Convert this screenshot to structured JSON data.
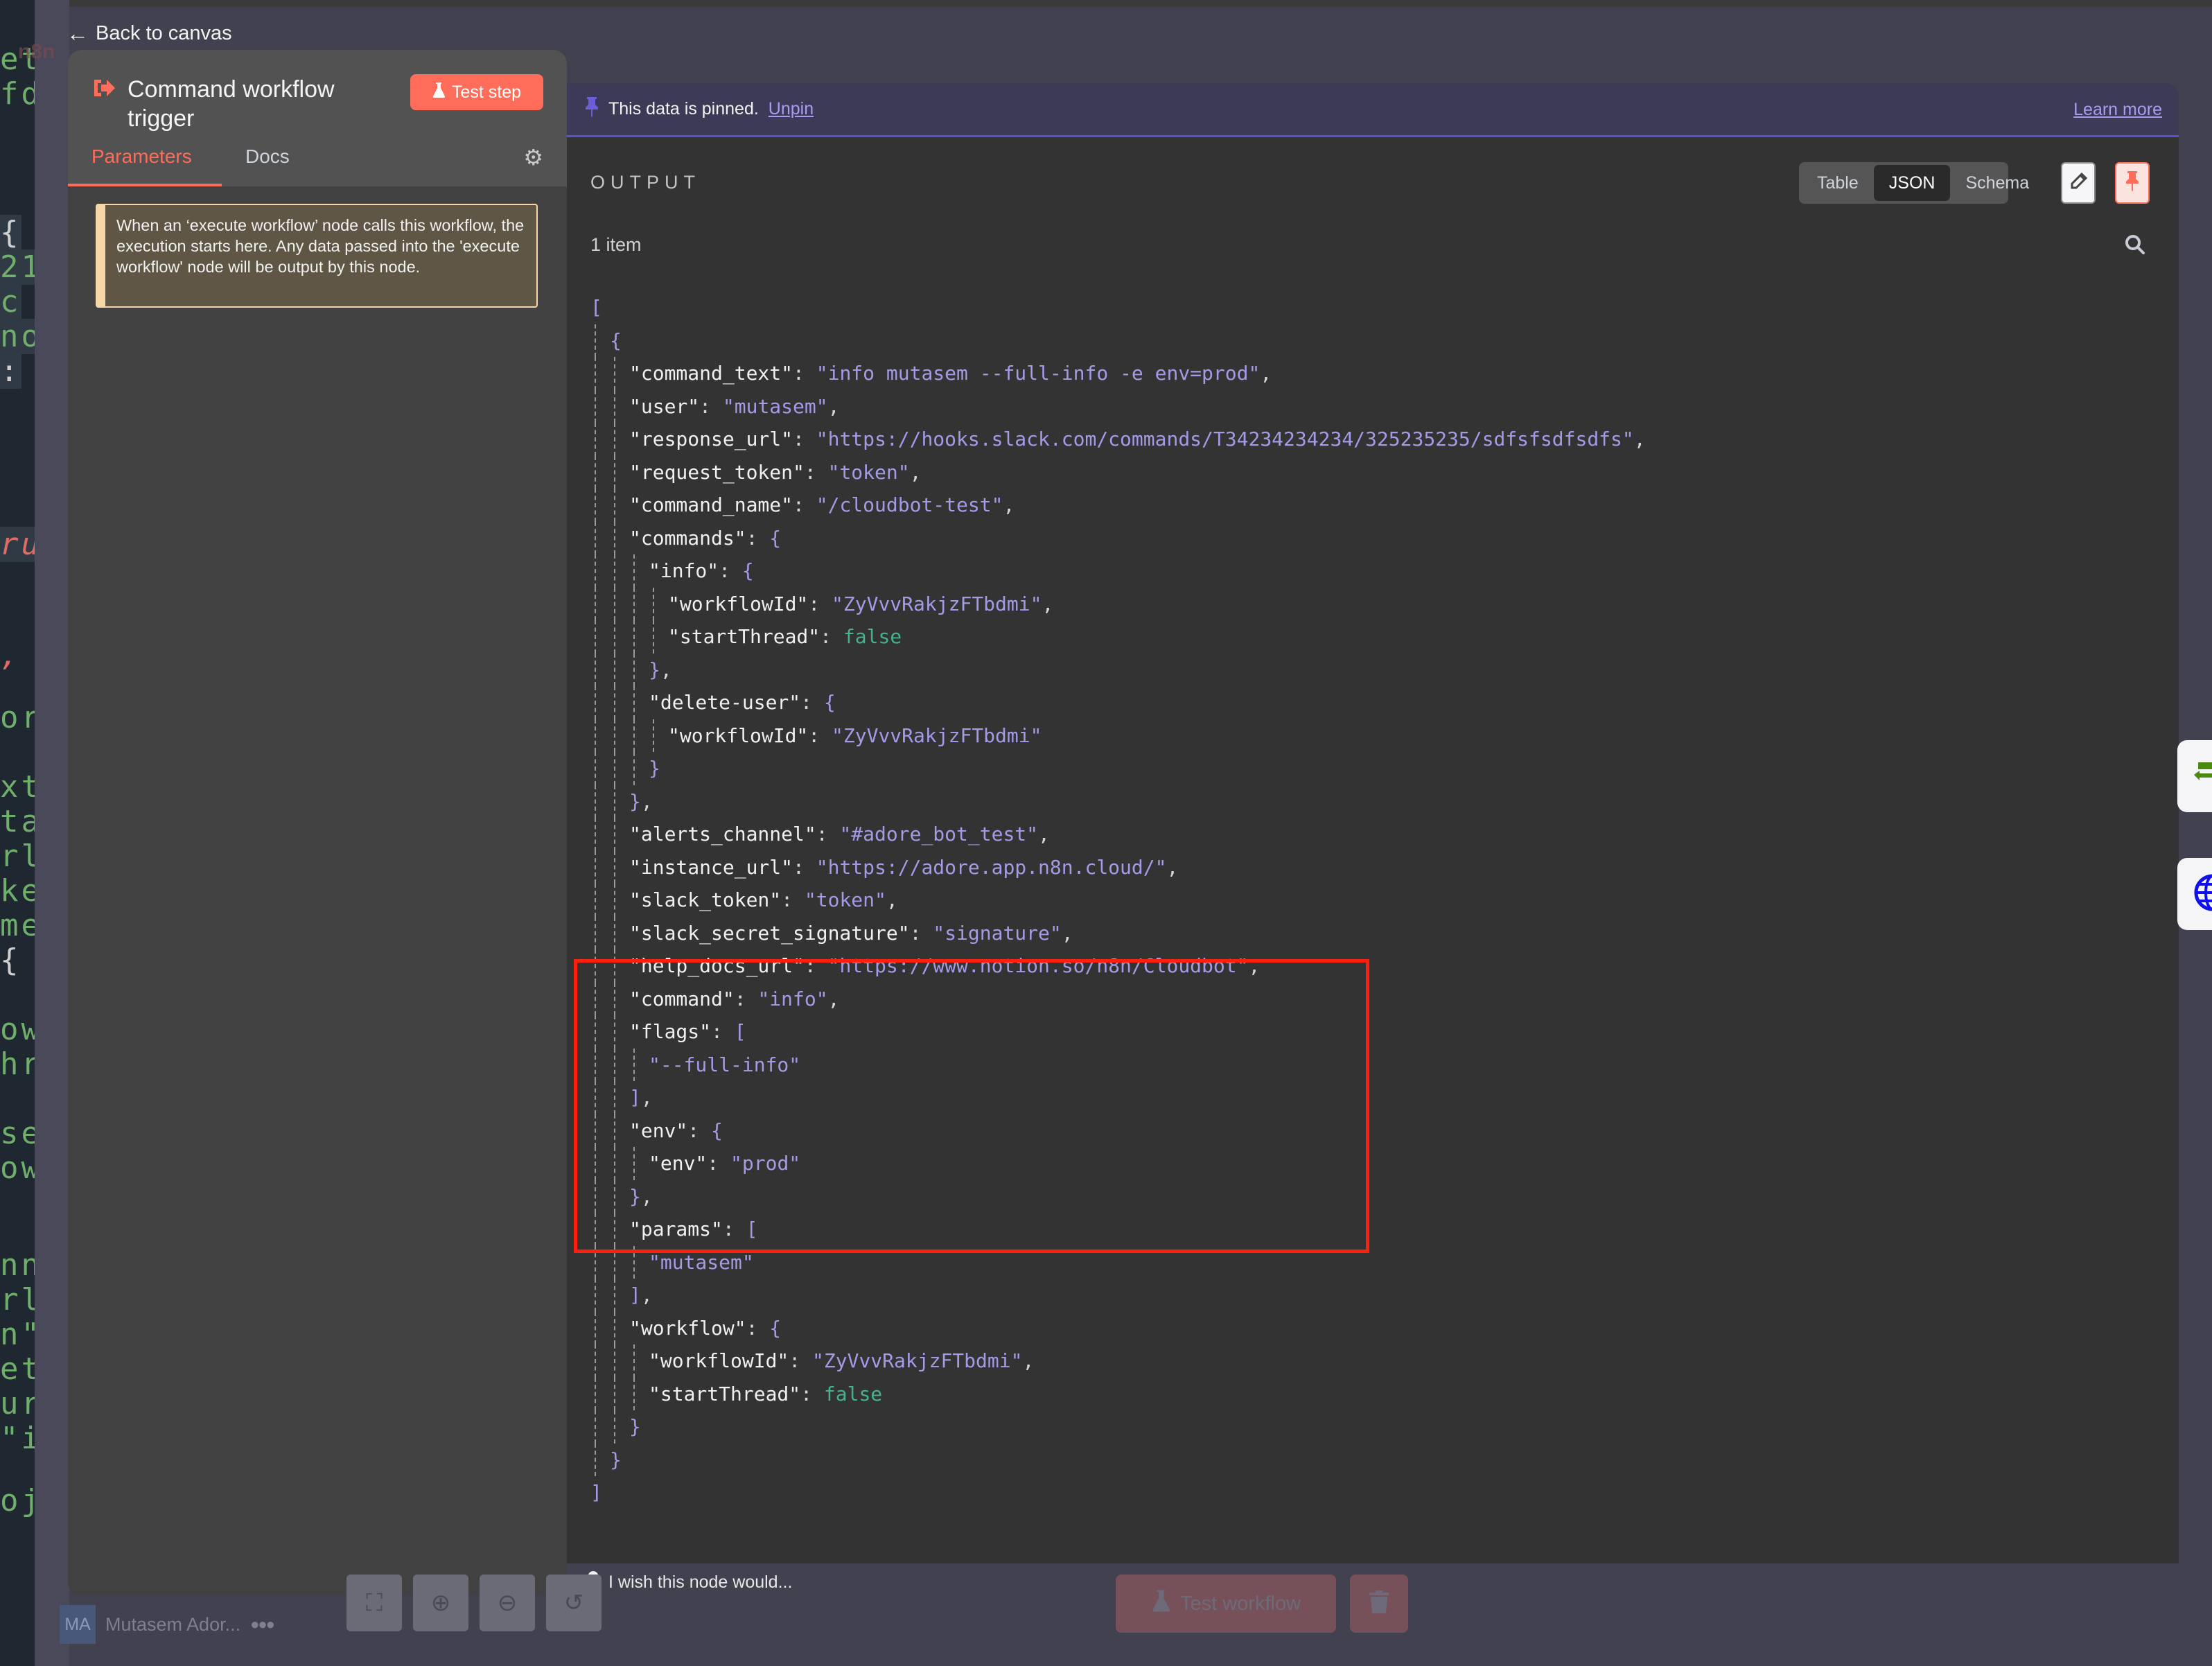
{
  "background_code": {
    "lines": [
      {
        "text": "et",
        "cls": ""
      },
      {
        "text": "fd",
        "cls": ""
      },
      {
        "text": " {",
        "cls": "white hl"
      },
      {
        "text": "21",
        "cls": "hl"
      },
      {
        "text": " c",
        "cls": "hl"
      },
      {
        "text": "no",
        "cls": "hl"
      },
      {
        "text": ":",
        "cls": "white hl"
      },
      {
        "text": "ru",
        "cls": "red hl"
      },
      {
        "text": ",",
        "cls": "red"
      },
      {
        "text": "or",
        "cls": ""
      },
      {
        "text": "xt",
        "cls": ""
      },
      {
        "text": "ta",
        "cls": ""
      },
      {
        "text": "rl",
        "cls": ""
      },
      {
        "text": "ke",
        "cls": ""
      },
      {
        "text": "me",
        "cls": ""
      },
      {
        "text": " {",
        "cls": "white"
      },
      {
        "text": "ow",
        "cls": ""
      },
      {
        "text": "hr",
        "cls": ""
      },
      {
        "text": "se",
        "cls": ""
      },
      {
        "text": "ow",
        "cls": ""
      },
      {
        "text": "nn",
        "cls": ""
      },
      {
        "text": "rl",
        "cls": ""
      },
      {
        "text": "n\"",
        "cls": ""
      },
      {
        "text": "et",
        "cls": ""
      },
      {
        "text": "ur",
        "cls": ""
      },
      {
        "text": "\"i",
        "cls": ""
      },
      {
        "text": "oj",
        "cls": ""
      }
    ]
  },
  "nav": {
    "back_label": "Back to canvas",
    "logo_text": "n8n"
  },
  "node_panel": {
    "title": "Command workflow trigger",
    "test_step_label": "Test step",
    "tabs": [
      {
        "label": "Parameters",
        "active": true
      },
      {
        "label": "Docs",
        "active": false
      }
    ],
    "callout": "When an ‘execute workflow’ node calls this workflow, the execution starts here. Any data passed into the 'execute workflow' node will be output by this node."
  },
  "output_panel": {
    "pinned_text": "This data is pinned.",
    "unpin_label": "Unpin",
    "learn_more_label": "Learn more",
    "section_label": "OUTPUT",
    "view_options": [
      {
        "label": "Table",
        "active": false
      },
      {
        "label": "JSON",
        "active": true
      },
      {
        "label": "Schema",
        "active": false
      }
    ],
    "items_count": "1 item",
    "json_lines": [
      {
        "d": 0,
        "t": [
          [
            "p",
            "["
          ]
        ]
      },
      {
        "d": 1,
        "t": [
          [
            "p",
            "{"
          ]
        ]
      },
      {
        "d": 2,
        "t": [
          [
            "k",
            "\"command_text\""
          ],
          [
            "c",
            ": "
          ],
          [
            "s",
            "\"info mutasem --full-info -e env=prod\""
          ],
          [
            "c",
            ","
          ]
        ]
      },
      {
        "d": 2,
        "t": [
          [
            "k",
            "\"user\""
          ],
          [
            "c",
            ": "
          ],
          [
            "s",
            "\"mutasem\""
          ],
          [
            "c",
            ","
          ]
        ]
      },
      {
        "d": 2,
        "t": [
          [
            "k",
            "\"response_url\""
          ],
          [
            "c",
            ": "
          ],
          [
            "s",
            "\"https://hooks.slack.com/commands/T34234234234/325235235/sdfsfsdfsdfs\""
          ],
          [
            "c",
            ","
          ]
        ]
      },
      {
        "d": 2,
        "t": [
          [
            "k",
            "\"request_token\""
          ],
          [
            "c",
            ": "
          ],
          [
            "s",
            "\"token\""
          ],
          [
            "c",
            ","
          ]
        ]
      },
      {
        "d": 2,
        "t": [
          [
            "k",
            "\"command_name\""
          ],
          [
            "c",
            ": "
          ],
          [
            "s",
            "\"/cloudbot-test\""
          ],
          [
            "c",
            ","
          ]
        ]
      },
      {
        "d": 2,
        "t": [
          [
            "k",
            "\"commands\""
          ],
          [
            "c",
            ": "
          ],
          [
            "p",
            "{"
          ]
        ]
      },
      {
        "d": 3,
        "t": [
          [
            "k",
            "\"info\""
          ],
          [
            "c",
            ": "
          ],
          [
            "p",
            "{"
          ]
        ]
      },
      {
        "d": 4,
        "t": [
          [
            "k",
            "\"workflowId\""
          ],
          [
            "c",
            ": "
          ],
          [
            "s",
            "\"ZyVvvRakjzFTbdmi\""
          ],
          [
            "c",
            ","
          ]
        ]
      },
      {
        "d": 4,
        "t": [
          [
            "k",
            "\"startThread\""
          ],
          [
            "c",
            ": "
          ],
          [
            "b",
            "false"
          ]
        ]
      },
      {
        "d": 3,
        "t": [
          [
            "p",
            "}"
          ],
          [
            "c",
            ","
          ]
        ]
      },
      {
        "d": 3,
        "t": [
          [
            "k",
            "\"delete-user\""
          ],
          [
            "c",
            ": "
          ],
          [
            "p",
            "{"
          ]
        ]
      },
      {
        "d": 4,
        "t": [
          [
            "k",
            "\"workflowId\""
          ],
          [
            "c",
            ": "
          ],
          [
            "s",
            "\"ZyVvvRakjzFTbdmi\""
          ]
        ]
      },
      {
        "d": 3,
        "t": [
          [
            "p",
            "}"
          ]
        ]
      },
      {
        "d": 2,
        "t": [
          [
            "p",
            "}"
          ],
          [
            "c",
            ","
          ]
        ]
      },
      {
        "d": 2,
        "t": [
          [
            "k",
            "\"alerts_channel\""
          ],
          [
            "c",
            ": "
          ],
          [
            "s",
            "\"#adore_bot_test\""
          ],
          [
            "c",
            ","
          ]
        ]
      },
      {
        "d": 2,
        "t": [
          [
            "k",
            "\"instance_url\""
          ],
          [
            "c",
            ": "
          ],
          [
            "s",
            "\"https://adore.app.n8n.cloud/\""
          ],
          [
            "c",
            ","
          ]
        ]
      },
      {
        "d": 2,
        "t": [
          [
            "k",
            "\"slack_token\""
          ],
          [
            "c",
            ": "
          ],
          [
            "s",
            "\"token\""
          ],
          [
            "c",
            ","
          ]
        ]
      },
      {
        "d": 2,
        "t": [
          [
            "k",
            "\"slack_secret_signature\""
          ],
          [
            "c",
            ": "
          ],
          [
            "s",
            "\"signature\""
          ],
          [
            "c",
            ","
          ]
        ]
      },
      {
        "d": 2,
        "t": [
          [
            "k",
            "\"help_docs_url\""
          ],
          [
            "c",
            ": "
          ],
          [
            "s",
            "\"https://www.notion.so/n8n/Cloudbot\""
          ],
          [
            "c",
            ","
          ]
        ]
      },
      {
        "d": 2,
        "t": [
          [
            "k",
            "\"command\""
          ],
          [
            "c",
            ": "
          ],
          [
            "s",
            "\"info\""
          ],
          [
            "c",
            ","
          ]
        ]
      },
      {
        "d": 2,
        "t": [
          [
            "k",
            "\"flags\""
          ],
          [
            "c",
            ": "
          ],
          [
            "p",
            "["
          ]
        ]
      },
      {
        "d": 3,
        "t": [
          [
            "s",
            "\"--full-info\""
          ]
        ]
      },
      {
        "d": 2,
        "t": [
          [
            "p",
            "]"
          ],
          [
            "c",
            ","
          ]
        ]
      },
      {
        "d": 2,
        "t": [
          [
            "k",
            "\"env\""
          ],
          [
            "c",
            ": "
          ],
          [
            "p",
            "{"
          ]
        ]
      },
      {
        "d": 3,
        "t": [
          [
            "k",
            "\"env\""
          ],
          [
            "c",
            ": "
          ],
          [
            "s",
            "\"prod\""
          ]
        ]
      },
      {
        "d": 2,
        "t": [
          [
            "p",
            "}"
          ],
          [
            "c",
            ","
          ]
        ]
      },
      {
        "d": 2,
        "t": [
          [
            "k",
            "\"params\""
          ],
          [
            "c",
            ": "
          ],
          [
            "p",
            "["
          ]
        ]
      },
      {
        "d": 3,
        "t": [
          [
            "s",
            "\"mutasem\""
          ]
        ]
      },
      {
        "d": 2,
        "t": [
          [
            "p",
            "]"
          ],
          [
            "c",
            ","
          ]
        ]
      },
      {
        "d": 2,
        "t": [
          [
            "k",
            "\"workflow\""
          ],
          [
            "c",
            ": "
          ],
          [
            "p",
            "{"
          ]
        ]
      },
      {
        "d": 3,
        "t": [
          [
            "k",
            "\"workflowId\""
          ],
          [
            "c",
            ": "
          ],
          [
            "s",
            "\"ZyVvvRakjzFTbdmi\""
          ],
          [
            "c",
            ","
          ]
        ]
      },
      {
        "d": 3,
        "t": [
          [
            "k",
            "\"startThread\""
          ],
          [
            "c",
            ": "
          ],
          [
            "b",
            "false"
          ]
        ]
      },
      {
        "d": 2,
        "t": [
          [
            "p",
            "}"
          ]
        ]
      },
      {
        "d": 1,
        "t": [
          [
            "p",
            "}"
          ]
        ]
      },
      {
        "d": 0,
        "t": [
          [
            "p",
            "]"
          ]
        ]
      }
    ],
    "highlighted_keys": [
      "command",
      "flags",
      "env",
      "params"
    ]
  },
  "side_nodes": [
    {
      "icon": "split-arrows-icon",
      "color": "#4a8a10"
    },
    {
      "icon": "globe-icon",
      "color": "#1010ee"
    }
  ],
  "bottom_bar": {
    "feedback_label": "I wish this node would...",
    "user_initials": "MA",
    "user_name": "Mutasem Ador...",
    "test_workflow_label": "Test workflow"
  },
  "colors": {
    "accent": "#ff6d5a",
    "pinned_accent": "#5b4fd3",
    "json_string": "#a39be6",
    "json_boolean": "#46b28c",
    "highlight_border": "#ff1f0f"
  }
}
